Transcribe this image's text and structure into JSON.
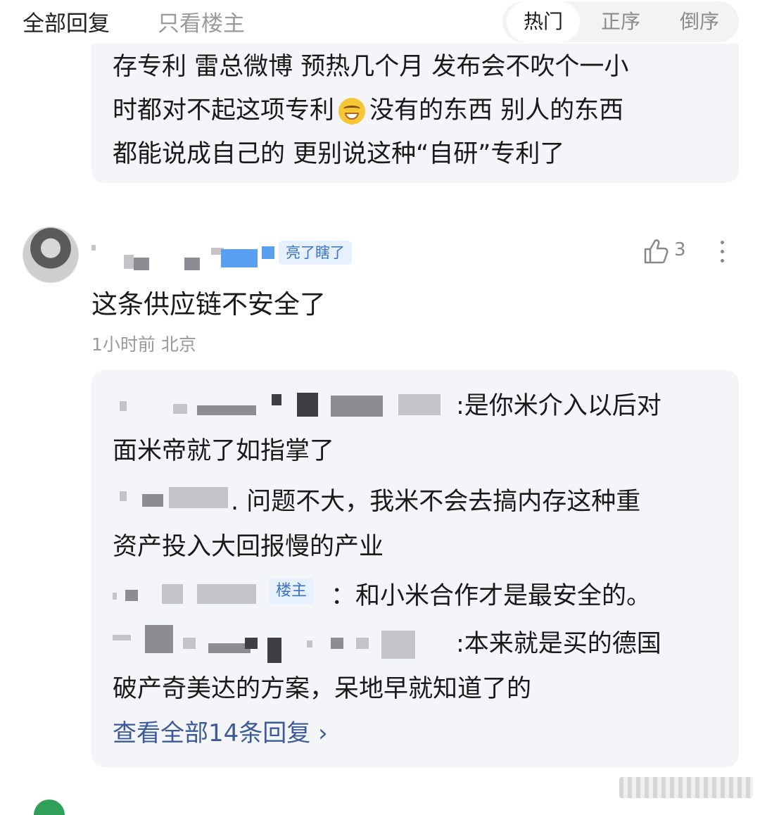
{
  "header": {
    "tab_all": "全部回复",
    "tab_op": "只看楼主",
    "sort": {
      "hot": "热门",
      "asc": "正序",
      "desc": "倒序",
      "active": "hot"
    }
  },
  "quoted_block": {
    "line1": "存专利 雷总微博 预热几个月 发布会不吹个一小",
    "line2a": "时都对不起这项专利",
    "line2b": "没有的东西 别人的东西",
    "line3": "都能说成自己的 更别说这种“自研”专利了"
  },
  "comment": {
    "badge": "亮了瞎了",
    "likes": "3",
    "text": "这条供应链不安全了",
    "time_location": "1小时前 北京"
  },
  "replies": [
    {
      "text_l1": ":是你米介入以后对",
      "text_l2": "面米帝就了如指掌了"
    },
    {
      "text_l1": ". 问题不大，我米不会去搞内存这种重",
      "text_l2": "资产投入大回报慢的产业"
    },
    {
      "tag": "楼主",
      "text_l1": "：和小米合作才是最安全的。"
    },
    {
      "text_l1": ":本来就是买的德国",
      "text_l2": "破产奇美达的方案，呆地早就知道了的"
    }
  ],
  "view_all": "查看全部14条回复 ›",
  "icons": {
    "like": "thumb-up-icon",
    "more": "more-vertical-icon",
    "emoji": "grinning-emoji-icon"
  }
}
